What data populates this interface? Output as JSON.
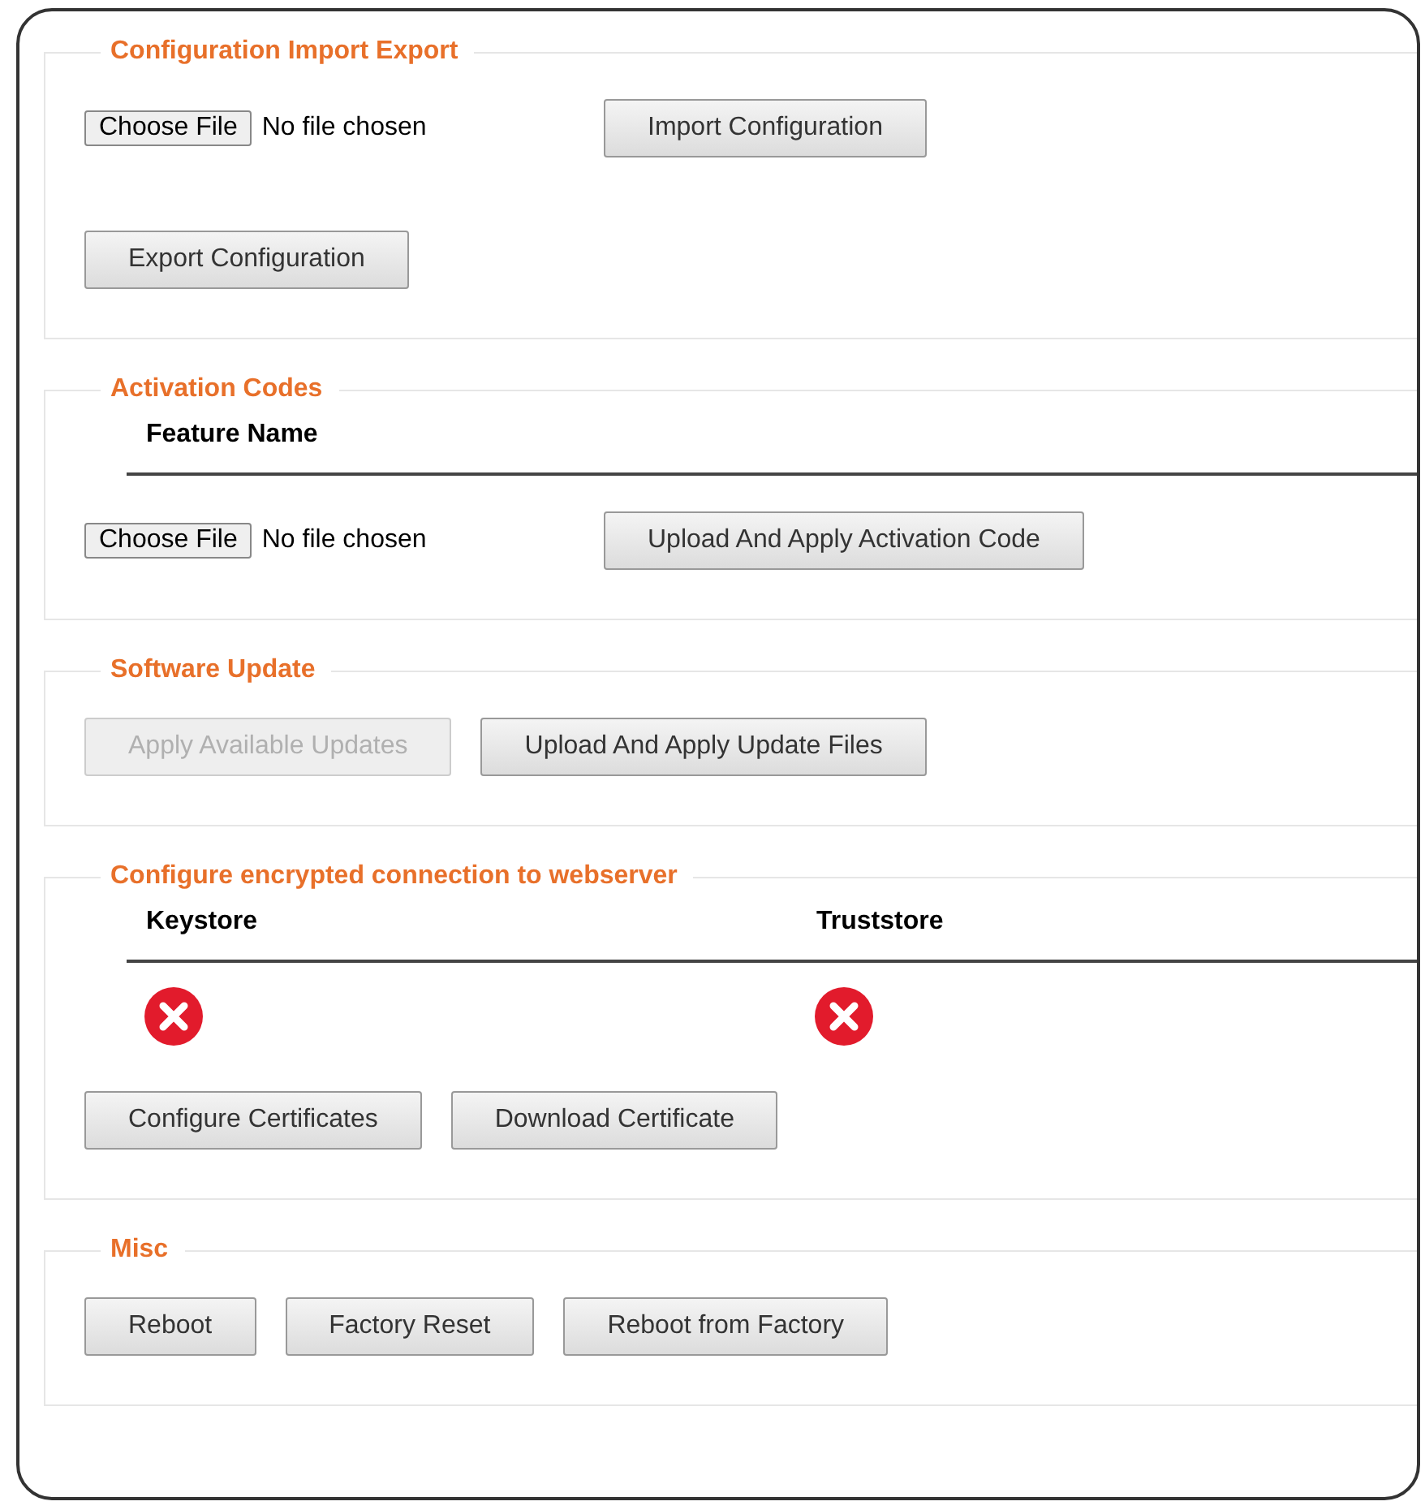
{
  "sections": [
    {
      "legend": "Configuration Import Export",
      "rows": [
        {
          "kind": "file",
          "button": "Choose File",
          "status": "No file chosen",
          "action": {
            "label": "Import Configuration",
            "disabled": false
          }
        },
        {
          "kind": "buttons",
          "buttons": [
            {
              "label": "Export Configuration",
              "disabled": false
            }
          ]
        }
      ]
    },
    {
      "legend": "Activation Codes",
      "rows": [
        {
          "kind": "table",
          "columns": [
            "Feature Name"
          ],
          "rows": []
        },
        {
          "kind": "file",
          "button": "Choose File",
          "status": "No file chosen",
          "action": {
            "label": "Upload And Apply Activation Code",
            "disabled": false
          }
        }
      ]
    },
    {
      "legend": "Software Update",
      "rows": [
        {
          "kind": "buttons",
          "buttons": [
            {
              "label": "Apply Available Updates",
              "disabled": true
            },
            {
              "label": "Upload And Apply Update Files",
              "disabled": false
            }
          ]
        }
      ]
    },
    {
      "legend": "Configure encrypted connection to webserver",
      "rows": [
        {
          "kind": "table",
          "columns": [
            "Keystore",
            "Truststore"
          ],
          "rows": [
            [
              {
                "ok": false
              },
              {
                "ok": false
              }
            ]
          ]
        },
        {
          "kind": "buttons",
          "buttons": [
            {
              "label": "Configure Certificates",
              "disabled": false
            },
            {
              "label": "Download Certificate",
              "disabled": false
            }
          ]
        }
      ]
    },
    {
      "legend": "Misc",
      "rows": [
        {
          "kind": "buttons",
          "buttons": [
            {
              "label": "Reboot",
              "disabled": false
            },
            {
              "label": "Factory Reset",
              "disabled": false
            },
            {
              "label": "Reboot from Factory",
              "disabled": false
            }
          ]
        }
      ]
    }
  ]
}
